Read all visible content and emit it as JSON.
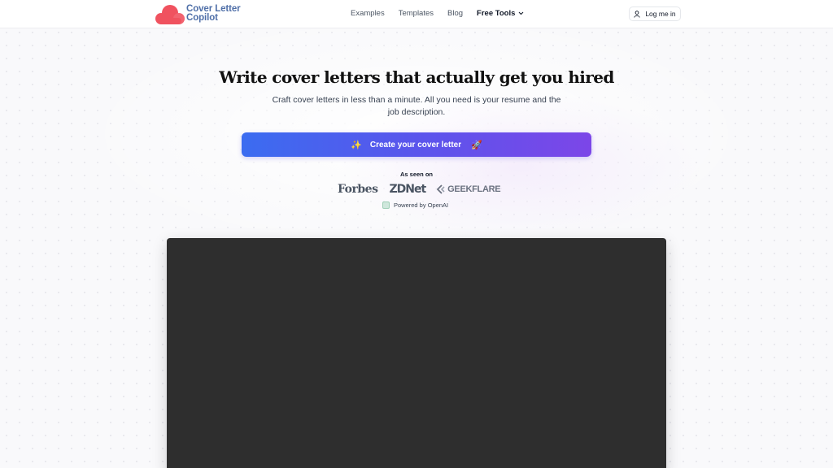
{
  "brand": {
    "name_line1": "Cover Letter",
    "name_line2": "Copilot",
    "color": "#f0525f"
  },
  "nav": {
    "items": [
      {
        "label": "Examples"
      },
      {
        "label": "Templates"
      },
      {
        "label": "Blog"
      }
    ],
    "free_tools": {
      "label": "Free Tools",
      "icon": "chevron-down-icon"
    },
    "login": {
      "label": "Log me in",
      "icon": "user-icon"
    }
  },
  "hero": {
    "title": "Write cover letters that actually get you hired",
    "subtitle": "Craft cover letters in less than a minute. All you need is your resume and the job description.",
    "cta": {
      "label": "Create your cover letter",
      "icon_left": "✨",
      "icon_right": "🚀"
    },
    "cta_gradient": [
      "#3b6cf0",
      "#7c46e8"
    ]
  },
  "press": {
    "heading": "As seen on",
    "logos": [
      "Forbes",
      "ZDNet",
      "GEEKFLARE"
    ]
  },
  "powered_by": {
    "label": "Powered by OpenAI",
    "icon": "openai-icon"
  },
  "video": {
    "background": "#2e2e2e"
  }
}
